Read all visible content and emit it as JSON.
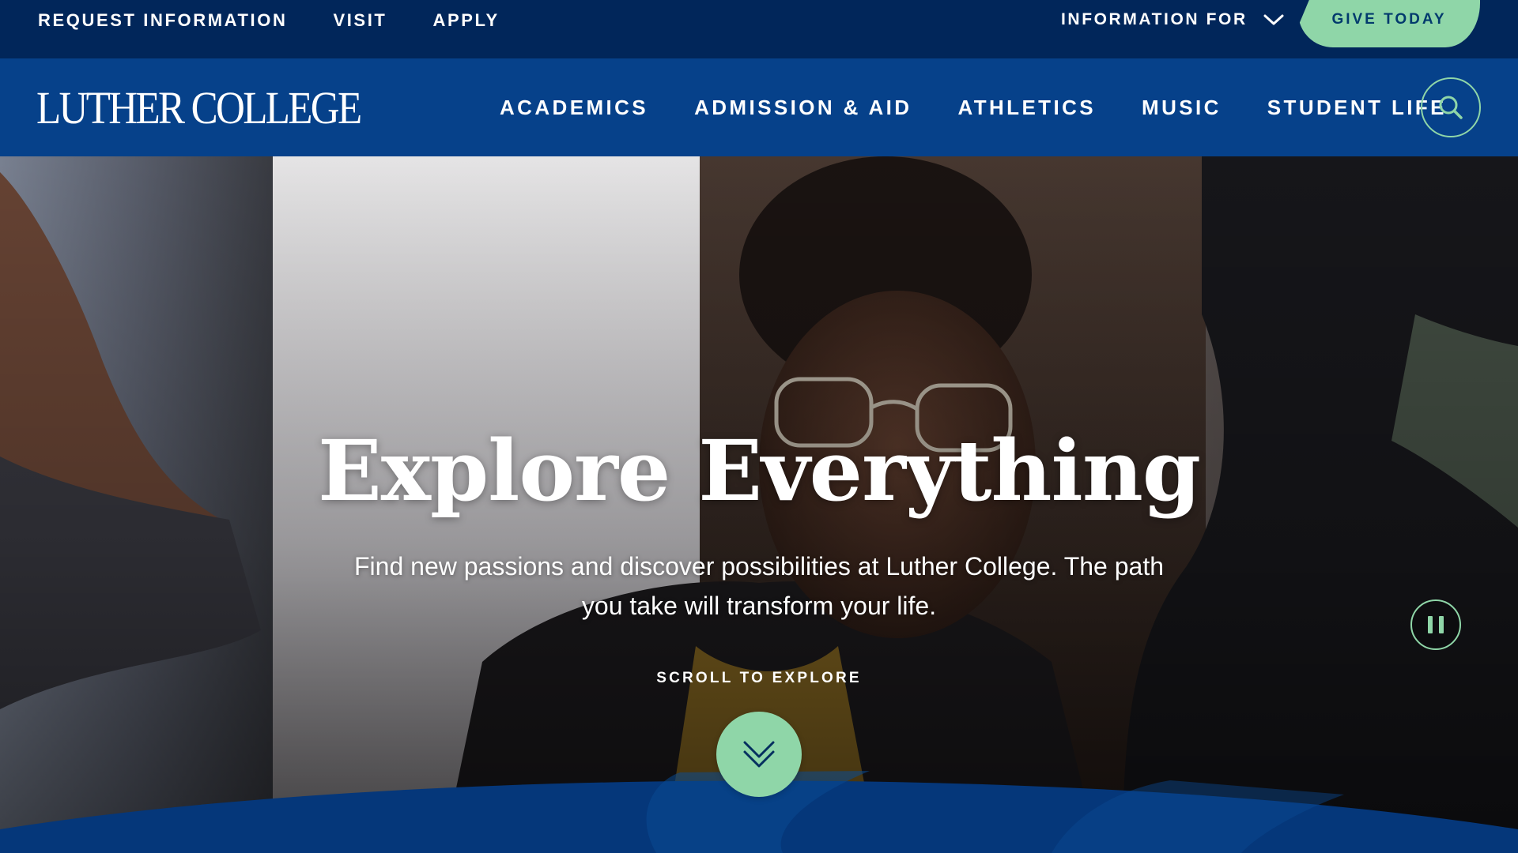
{
  "utility": {
    "links": [
      "REQUEST INFORMATION",
      "VISIT",
      "APPLY"
    ],
    "info_for": "INFORMATION FOR",
    "give_today": "GIVE TODAY"
  },
  "nav": {
    "logo": "LUTHER COLLEGE",
    "items": [
      "ACADEMICS",
      "ADMISSION & AID",
      "ATHLETICS",
      "MUSIC",
      "STUDENT LIFE"
    ]
  },
  "hero": {
    "title": "Explore Everything",
    "subtitle": "Find new passions and discover possibilities at Luther College. The path you take will transform your life.",
    "scroll_label": "SCROLL TO EXPLORE"
  },
  "icons": {
    "info_for": "chevron-down-icon",
    "search": "search-icon",
    "pause": "pause-icon",
    "scroll": "double-chevron-down-icon"
  },
  "colors": {
    "utility_bg": "#01265a",
    "nav_bg": "#06418a",
    "accent_green": "#8fd6a8",
    "arc_blue": "#05377a"
  }
}
